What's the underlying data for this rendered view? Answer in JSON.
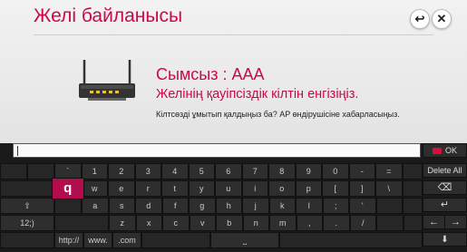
{
  "dialog": {
    "title": "Желі байланысы",
    "back_icon": "↩",
    "close_icon": "✕",
    "ssid_line": "Сымсыз : ААА",
    "prompt": "Желінің қауіпсіздік кілтін енгізіңіз.",
    "hint": "Кілтсөзді ұмытып қалдыңыз ба? AP өндірушісіне хабарласыңыз."
  },
  "keyboard": {
    "input_value": "",
    "ok_label": "OK",
    "delete_all_label": "Delete All",
    "row1": [
      "`",
      "1",
      "2",
      "3",
      "4",
      "5",
      "6",
      "7",
      "8",
      "9",
      "0",
      "-",
      "="
    ],
    "row2": [
      "q",
      "w",
      "e",
      "r",
      "t",
      "y",
      "u",
      "i",
      "o",
      "p",
      "[",
      "]",
      "\\"
    ],
    "row3": [
      "a",
      "s",
      "d",
      "f",
      "g",
      "h",
      "j",
      "k",
      "l",
      ";",
      "'"
    ],
    "row4": [
      "z",
      "x",
      "c",
      "v",
      "b",
      "n",
      "m",
      ",",
      ".",
      "/"
    ],
    "lang_label": "12;)",
    "shift_icon": "⇧",
    "backspace_icon": "⌫",
    "enter_icon": "↵",
    "left_icon": "←",
    "right_icon": "→",
    "download_icon": "⬇",
    "space_icon": "⎵",
    "shortcuts": [
      "http://",
      "www.",
      ".com"
    ],
    "selected_key": "q",
    "accent_color": "#c9094f"
  }
}
